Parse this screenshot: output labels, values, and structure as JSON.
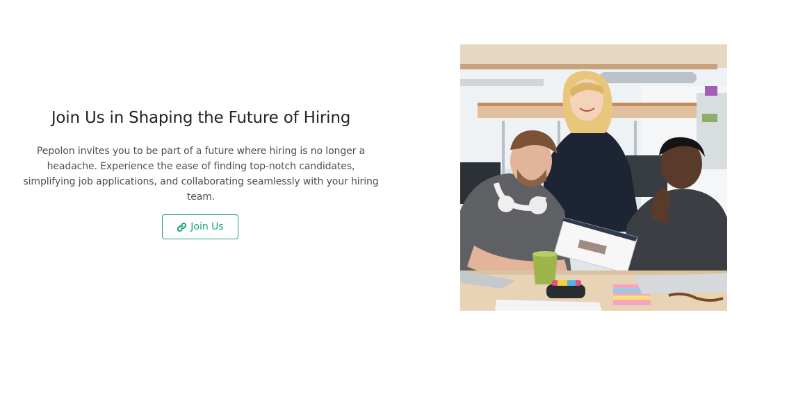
{
  "hero": {
    "title": "Join Us in Shaping the Future of Hiring",
    "description": "Pepolon invites you to be part of a future where hiring is no longer a headache. Experience the ease of finding top-notch candidates, simplifying job applications, and collaborating seamlessly with your hiring team.",
    "cta": {
      "label": "Join Us",
      "icon": "link-icon"
    },
    "image": {
      "subject": "team-collaboration-photo"
    }
  },
  "colors": {
    "accent": "#1aa37a",
    "heading": "#212529",
    "body_text": "#4a4f55",
    "background": "#ffffff"
  }
}
